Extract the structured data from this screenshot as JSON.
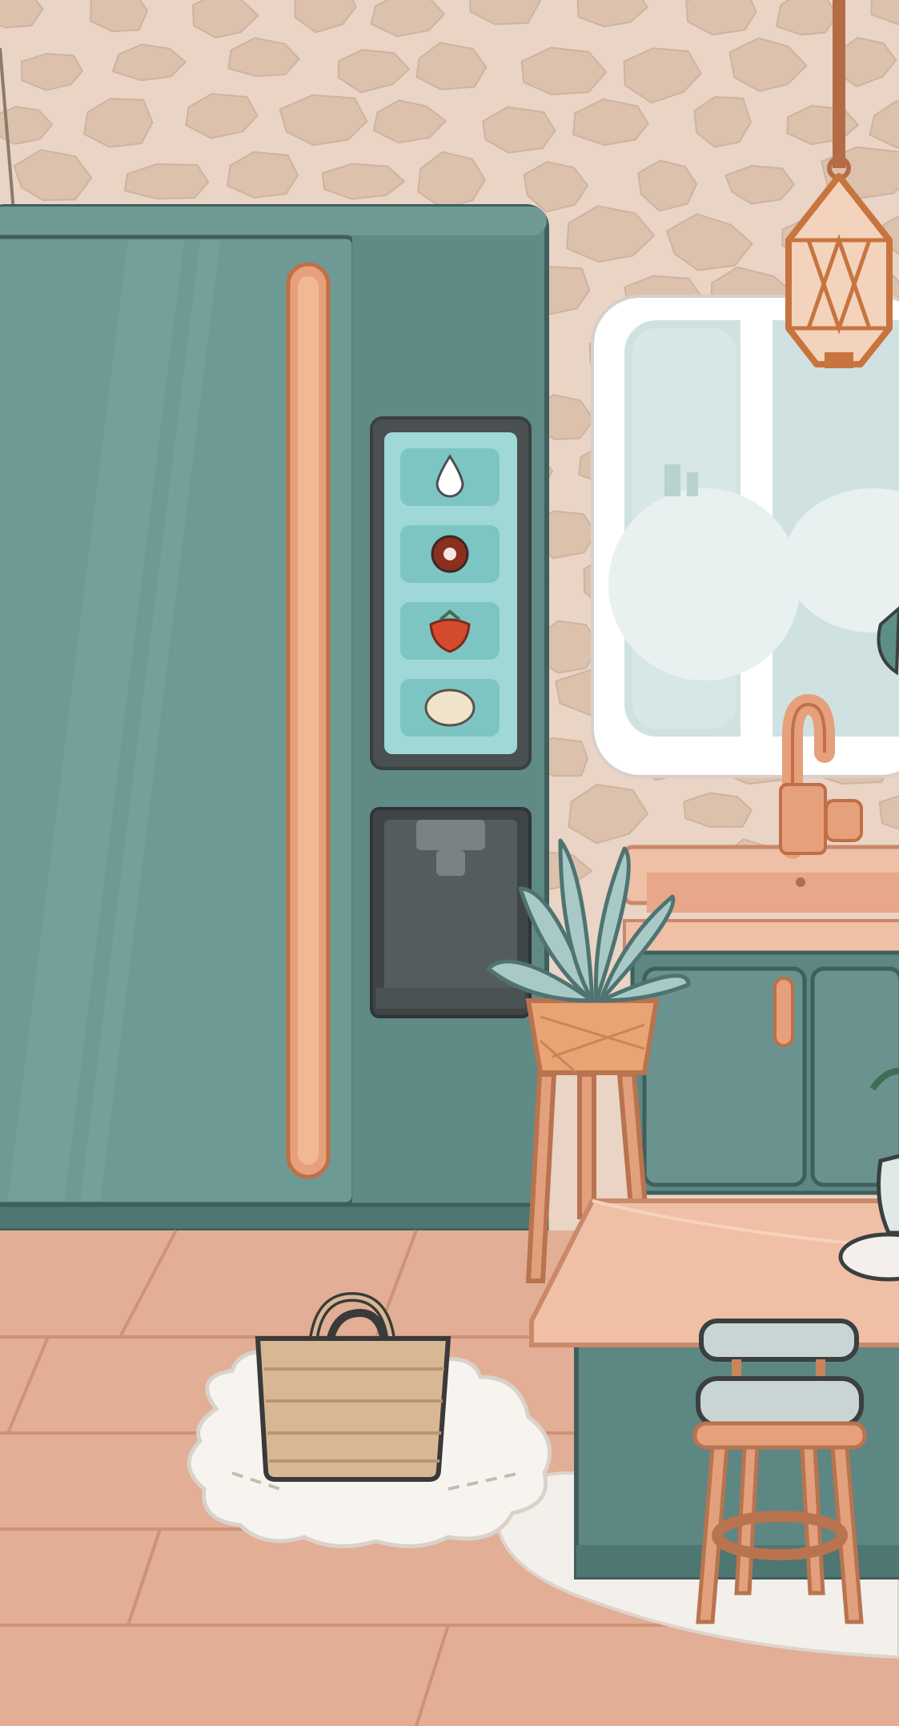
{
  "scene": {
    "name": "kitchen-room",
    "palette": {
      "wall": "#e9d4c6",
      "stone": "#dcc1ac",
      "stone_outline": "#cbae98",
      "fridge_body": "#5f8a86",
      "fridge_door": "#6e9a95",
      "fridge_outline": "#3f5f5c",
      "copper": "#e7a07c",
      "copper_outline": "#c06f47",
      "floor": "#e2ae95",
      "floor_line": "#cf9276",
      "dispenser_screen": "#9fd8d6",
      "counter": "#efc0a6",
      "cabinet": "#5d8783",
      "rug": "#f3efea",
      "window_frame": "#ffffff",
      "window_glass": "#cfe2e1"
    },
    "dispenser": {
      "options": [
        {
          "id": "water",
          "icon": "water-drop-icon"
        },
        {
          "id": "cola",
          "icon": "cola-icon"
        },
        {
          "id": "strawberry",
          "icon": "strawberry-icon"
        },
        {
          "id": "lemon",
          "icon": "lemon-icon"
        }
      ]
    },
    "objects": [
      "hanging-plant",
      "refrigerator",
      "drink-dispenser",
      "pendant-lamp",
      "window",
      "kitchen-faucet",
      "potted-plant-on-stand",
      "straw-basket",
      "round-rug",
      "kitchen-island",
      "bar-stool"
    ]
  }
}
